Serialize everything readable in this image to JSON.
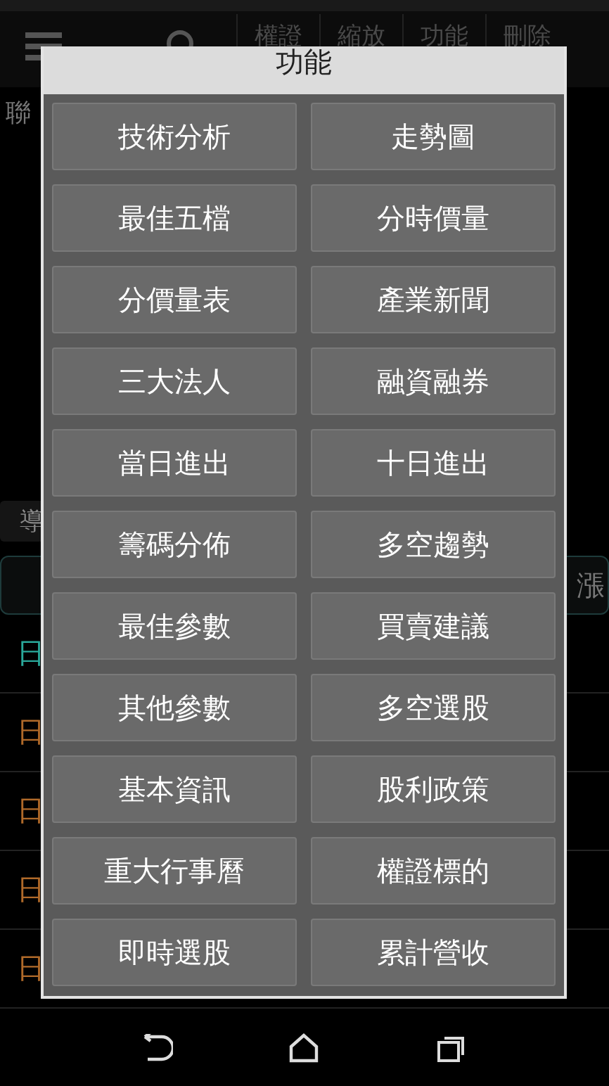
{
  "toolbar": {
    "tabs": [
      {
        "label": "權證"
      },
      {
        "label": "縮放"
      },
      {
        "label": "功能"
      },
      {
        "label": "刪除"
      }
    ]
  },
  "background": {
    "side_label": "聯",
    "chip": "導",
    "header_right": "漲",
    "rows": [
      {
        "label": "日",
        "selected": true
      },
      {
        "label": "日",
        "selected": false
      },
      {
        "label": "日",
        "selected": false
      },
      {
        "label": "日",
        "selected": false
      },
      {
        "label": "日",
        "selected": false
      }
    ]
  },
  "dialog": {
    "title": "功能",
    "buttons": [
      "技術分析",
      "走勢圖",
      "最佳五檔",
      "分時價量",
      "分價量表",
      "產業新聞",
      "三大法人",
      "融資融券",
      "當日進出",
      "十日進出",
      "籌碼分佈",
      "多空趨勢",
      "最佳參數",
      "買賣建議",
      "其他參數",
      "多空選股",
      "基本資訊",
      "股利政策",
      "重大行事曆",
      "權證標的",
      "即時選股",
      "累計營收"
    ]
  }
}
